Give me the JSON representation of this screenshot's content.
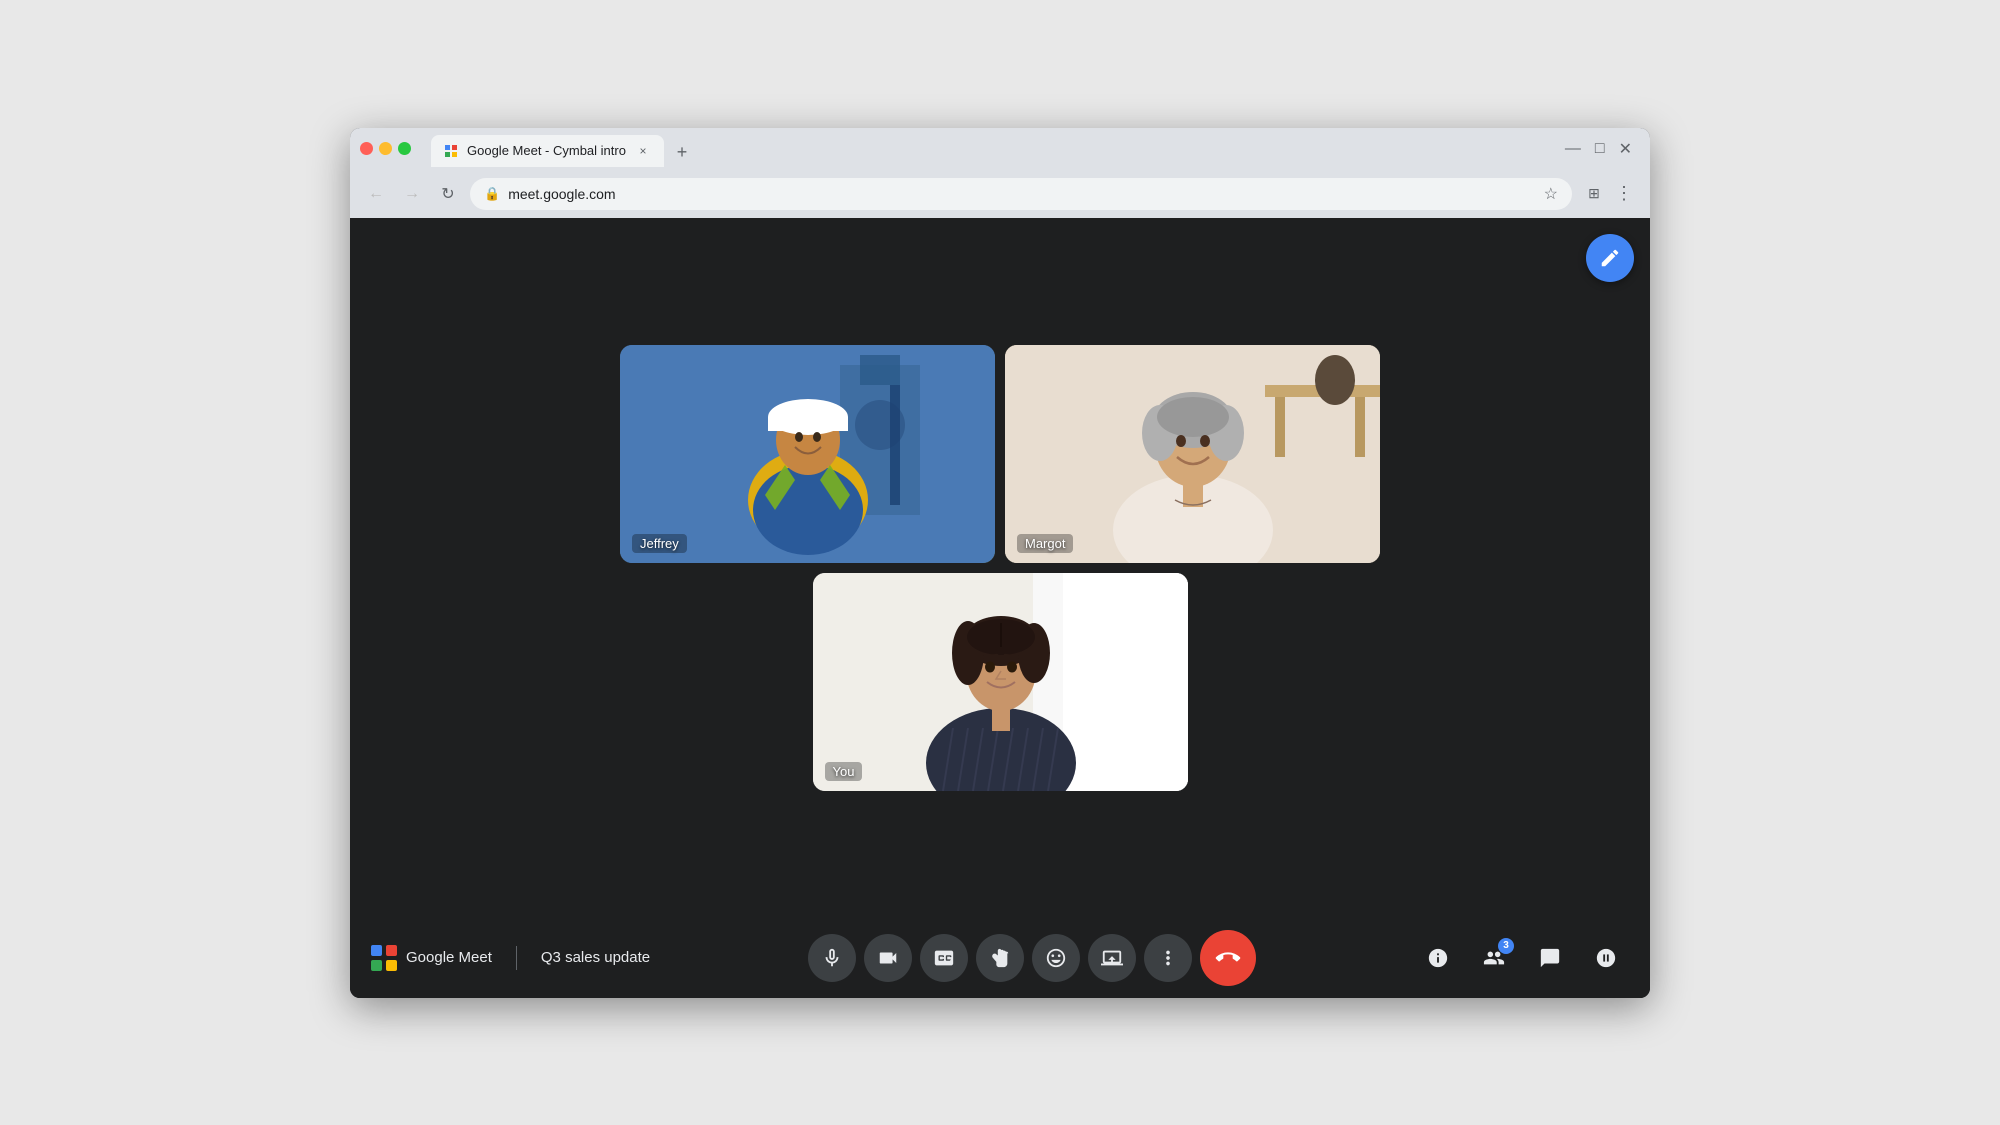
{
  "browser": {
    "tab_title": "Google Meet - Cymbal intro",
    "address_url": "",
    "new_tab_label": "+",
    "close_label": "×",
    "back_disabled": false,
    "forward_disabled": true,
    "window_minimize": "–",
    "window_maximize": "□",
    "window_close": "×"
  },
  "meet": {
    "app_name": "Google Meet",
    "meeting_name": "Q3 sales update",
    "edit_icon": "✏",
    "participants": [
      {
        "id": "jeffrey",
        "name": "Jeffrey",
        "bg_class": "jeffrey-bg"
      },
      {
        "id": "margot",
        "name": "Margot",
        "bg_class": "margot-bg"
      },
      {
        "id": "you",
        "name": "You",
        "bg_class": "you-bg"
      }
    ],
    "toolbar": {
      "mic_icon": "🎤",
      "camera_icon": "📷",
      "captions_icon": "CC",
      "hand_icon": "✋",
      "emoji_icon": "😊",
      "present_icon": "⬆",
      "more_icon": "⋮",
      "end_call_icon": "📞",
      "info_icon": "ⓘ",
      "people_icon": "👥",
      "chat_icon": "💬",
      "activities_icon": "⚡",
      "participant_count": "3"
    },
    "colors": {
      "bg": "#1e1f20",
      "toolbar_bg": "#1e1f20",
      "btn_bg": "#3c4043",
      "end_call": "#ea4335",
      "accent": "#4285f4",
      "text": "#e8eaed"
    }
  }
}
